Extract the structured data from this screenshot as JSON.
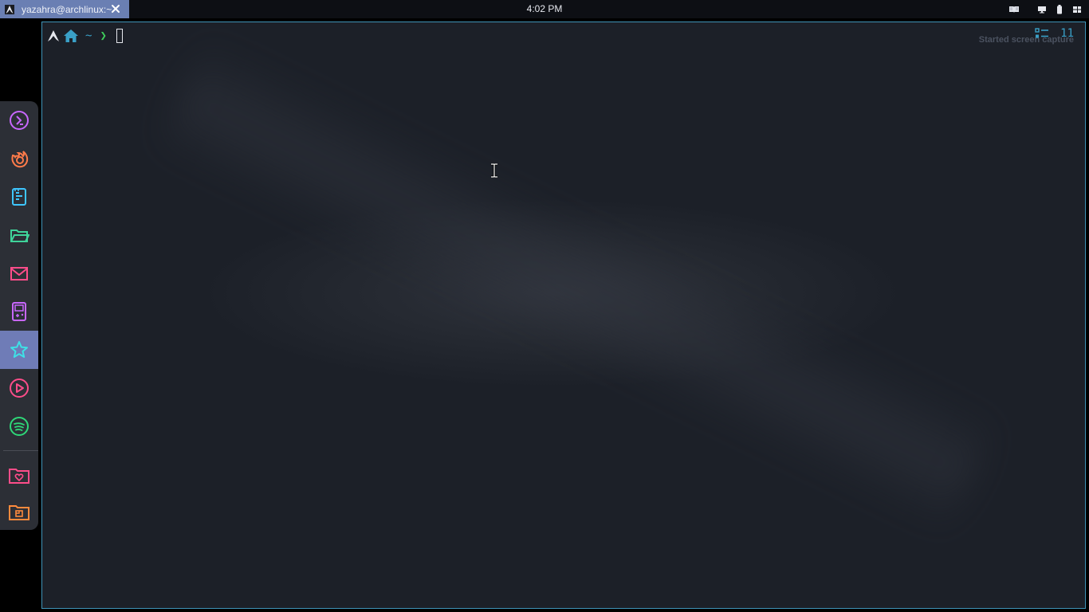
{
  "topbar": {
    "task": {
      "title": "yazahra@archlinux:~",
      "app_icon": "arch-icon",
      "close_icon": "close-icon"
    },
    "clock": "4:02 PM",
    "tray": [
      "book-icon",
      "monitor-icon",
      "battery-icon",
      "grid-icon"
    ]
  },
  "dock": {
    "items": [
      {
        "icon": "terminal-icon",
        "color": "#c867ff"
      },
      {
        "icon": "firefox-icon",
        "color": "#ff7b4a"
      },
      {
        "icon": "text-editor-icon",
        "color": "#3ec6ff"
      },
      {
        "icon": "folder-open-icon",
        "color": "#3fd39a"
      },
      {
        "icon": "mail-icon",
        "color": "#ff4d8a"
      },
      {
        "icon": "gameboy-icon",
        "color": "#c867ff"
      },
      {
        "icon": "star-icon",
        "color": "#3ee1e6",
        "active": true
      },
      {
        "icon": "play-icon",
        "color": "#ff4d8a"
      },
      {
        "icon": "spotify-icon",
        "color": "#2ed878"
      },
      {
        "icon": "folder-heart-icon",
        "color": "#ff4d8a"
      },
      {
        "icon": "folder-image-icon",
        "color": "#ff8a3d"
      }
    ]
  },
  "terminal": {
    "prompt_path": "~",
    "prompt_symbol": "❯",
    "right_status_number": "11",
    "notification": "Started screen capture",
    "colors": {
      "accent": "#3aa0c7",
      "prompt_arrow": "#3fcf5b",
      "border": "#3f94b8"
    }
  }
}
